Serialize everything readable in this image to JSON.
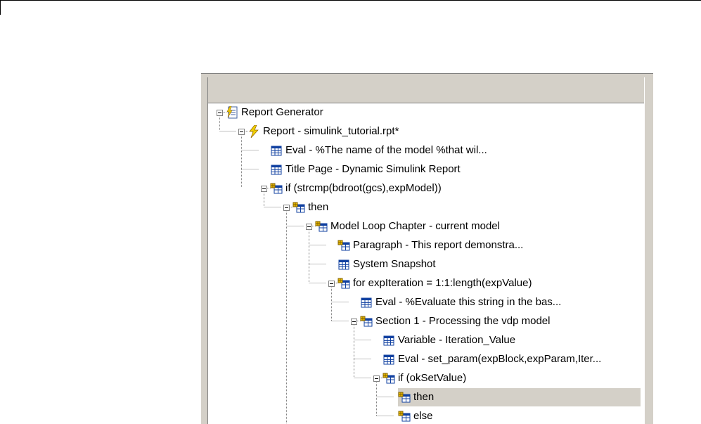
{
  "tree": {
    "nodes": [
      {
        "label": "Report Generator",
        "icon": "report-generator-icon",
        "expanded": true
      },
      {
        "label": "Report - simulink_tutorial.rpt*",
        "icon": "report-icon",
        "expanded": true
      },
      {
        "label": "Eval - %The name of the model %that wil...",
        "icon": "component-icon"
      },
      {
        "label": "Title Page - Dynamic Simulink Report",
        "icon": "component-icon"
      },
      {
        "label": "if (strcmp(bdroot(gcs),expModel))",
        "icon": "logical-component-icon",
        "expanded": true
      },
      {
        "label": "then",
        "icon": "logical-component-icon",
        "expanded": true
      },
      {
        "label": "Model Loop Chapter - current model",
        "icon": "logical-component-icon",
        "expanded": true
      },
      {
        "label": "Paragraph - This report demonstra...",
        "icon": "logical-component-icon"
      },
      {
        "label": "System Snapshot",
        "icon": "component-icon"
      },
      {
        "label": "for expIteration = 1:1:length(expValue)",
        "icon": "logical-component-icon",
        "expanded": true
      },
      {
        "label": "Eval - %Evaluate this string in the bas...",
        "icon": "component-icon"
      },
      {
        "label": "Section 1 - Processing the vdp model",
        "icon": "logical-component-icon",
        "expanded": true
      },
      {
        "label": "Variable - Iteration_Value",
        "icon": "component-icon"
      },
      {
        "label": "Eval - set_param(expBlock,expParam,Iter...",
        "icon": "component-icon"
      },
      {
        "label": "if (okSetValue)",
        "icon": "logical-component-icon",
        "expanded": true
      },
      {
        "label": "then",
        "icon": "logical-component-icon",
        "selected": true
      },
      {
        "label": "else",
        "icon": "logical-component-icon"
      }
    ]
  }
}
